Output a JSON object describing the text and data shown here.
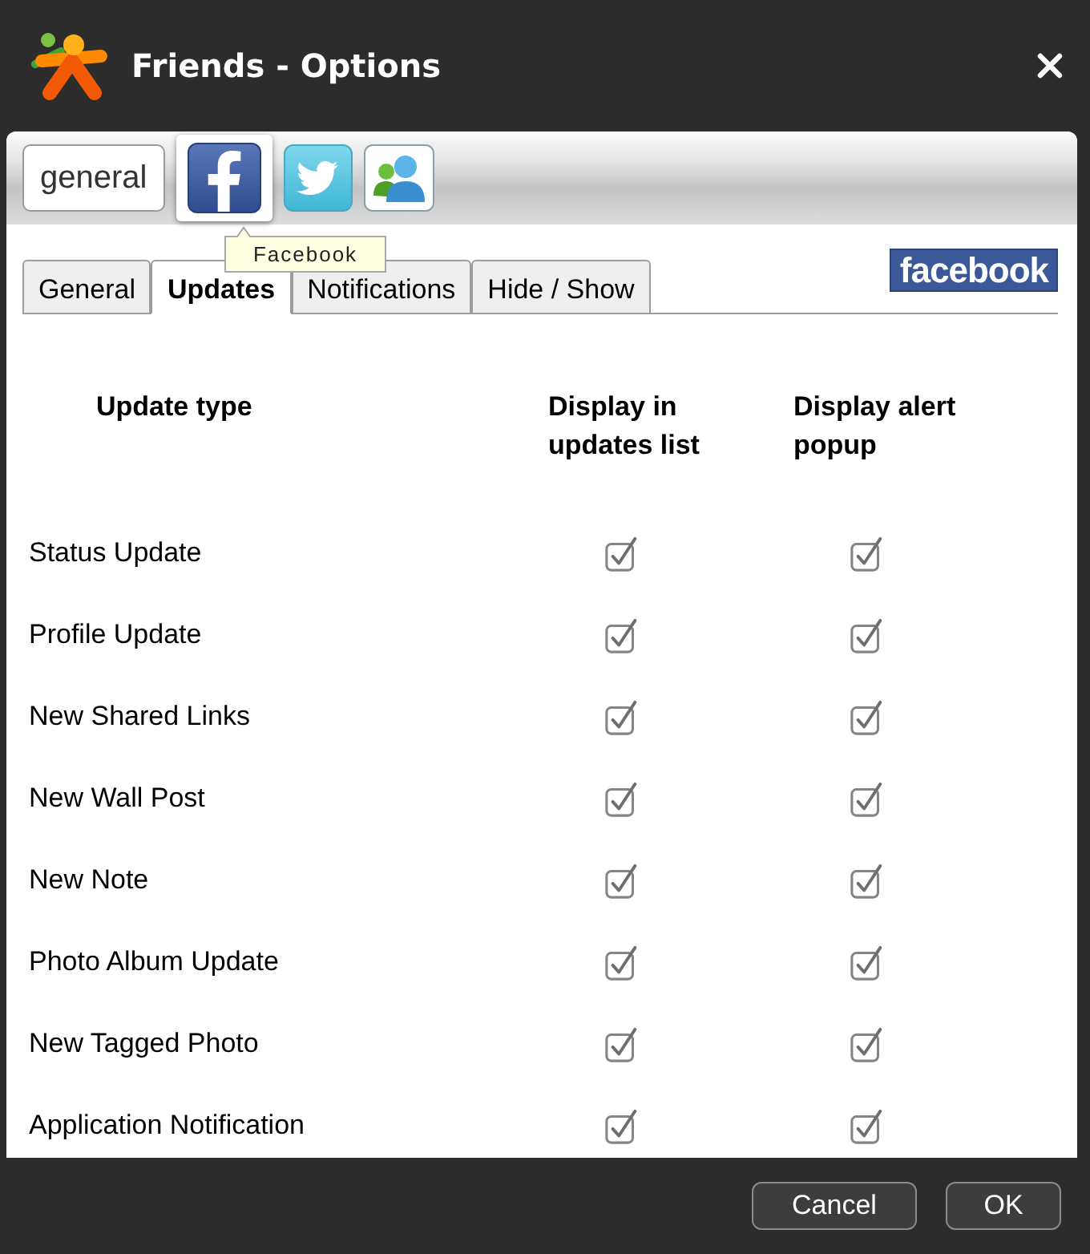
{
  "window": {
    "title": "Friends - Options"
  },
  "toolbar": [
    {
      "kind": "text",
      "label": "general",
      "selected": false
    },
    {
      "kind": "facebook",
      "selected": true
    },
    {
      "kind": "twitter",
      "selected": false
    },
    {
      "kind": "messenger",
      "selected": false
    }
  ],
  "tooltip": "Facebook",
  "tabs": [
    {
      "label": "General",
      "selected": false
    },
    {
      "label": "Updates",
      "selected": true
    },
    {
      "label": "Notifications",
      "selected": false
    },
    {
      "label": "Hide / Show",
      "selected": false
    }
  ],
  "brand_logo": "facebook",
  "table": {
    "columns": [
      "Update type",
      "Display in updates list",
      "Display alert popup"
    ],
    "rows": [
      {
        "label": "Status Update",
        "in_list": true,
        "alert_popup": true
      },
      {
        "label": "Profile Update",
        "in_list": true,
        "alert_popup": true
      },
      {
        "label": "New Shared Links",
        "in_list": true,
        "alert_popup": true
      },
      {
        "label": "New Wall Post",
        "in_list": true,
        "alert_popup": true
      },
      {
        "label": "New Note",
        "in_list": true,
        "alert_popup": true
      },
      {
        "label": "Photo Album Update",
        "in_list": true,
        "alert_popup": true
      },
      {
        "label": "New Tagged Photo",
        "in_list": true,
        "alert_popup": true
      },
      {
        "label": "Application Notification",
        "in_list": true,
        "alert_popup": true
      }
    ]
  },
  "buttons": [
    {
      "label": "Cancel"
    },
    {
      "label": "OK"
    }
  ]
}
